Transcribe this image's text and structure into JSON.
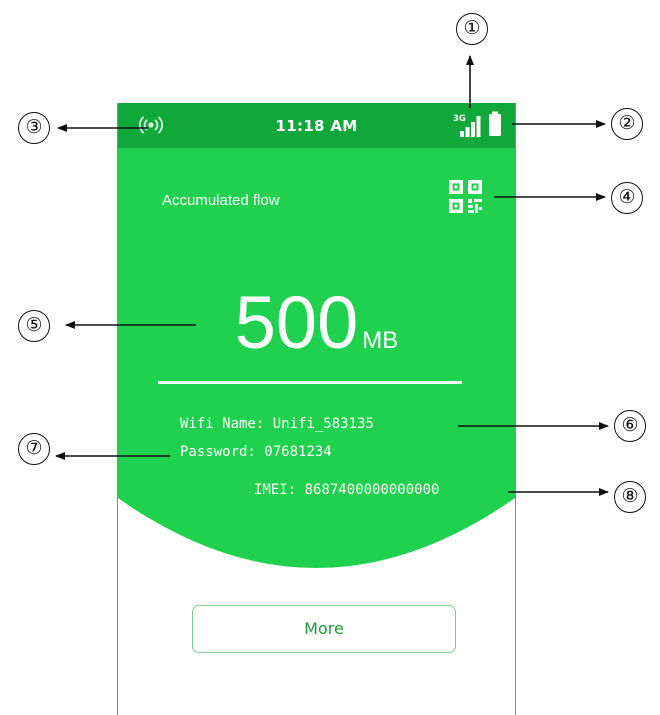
{
  "status_bar": {
    "time": "11:18 AM",
    "hotspot_icon": "hotspot-broadcast-icon",
    "network_type": "3G",
    "signal_icon": "signal-strength-icon",
    "battery_icon": "battery-icon"
  },
  "main": {
    "flow_label": "Accumulated flow",
    "qr_icon": "qr-code-icon",
    "usage_value": "500",
    "usage_unit": "MB",
    "wifi_name_label": "Wifi Name:",
    "wifi_name": "Unifi_583135",
    "password_label": "Password:",
    "password": "07681234",
    "imei_label": "IMEI:",
    "imei": "8687400000000000"
  },
  "actions": {
    "more_label": "More"
  },
  "callouts": [
    "①",
    "②",
    "③",
    "④",
    "⑤",
    "⑥",
    "⑦",
    "⑧"
  ],
  "colors": {
    "primary_green": "#1fd14e",
    "status_bar_green": "#10a83a",
    "button_text": "#1f9b3c",
    "button_border": "#7ccf8f"
  }
}
